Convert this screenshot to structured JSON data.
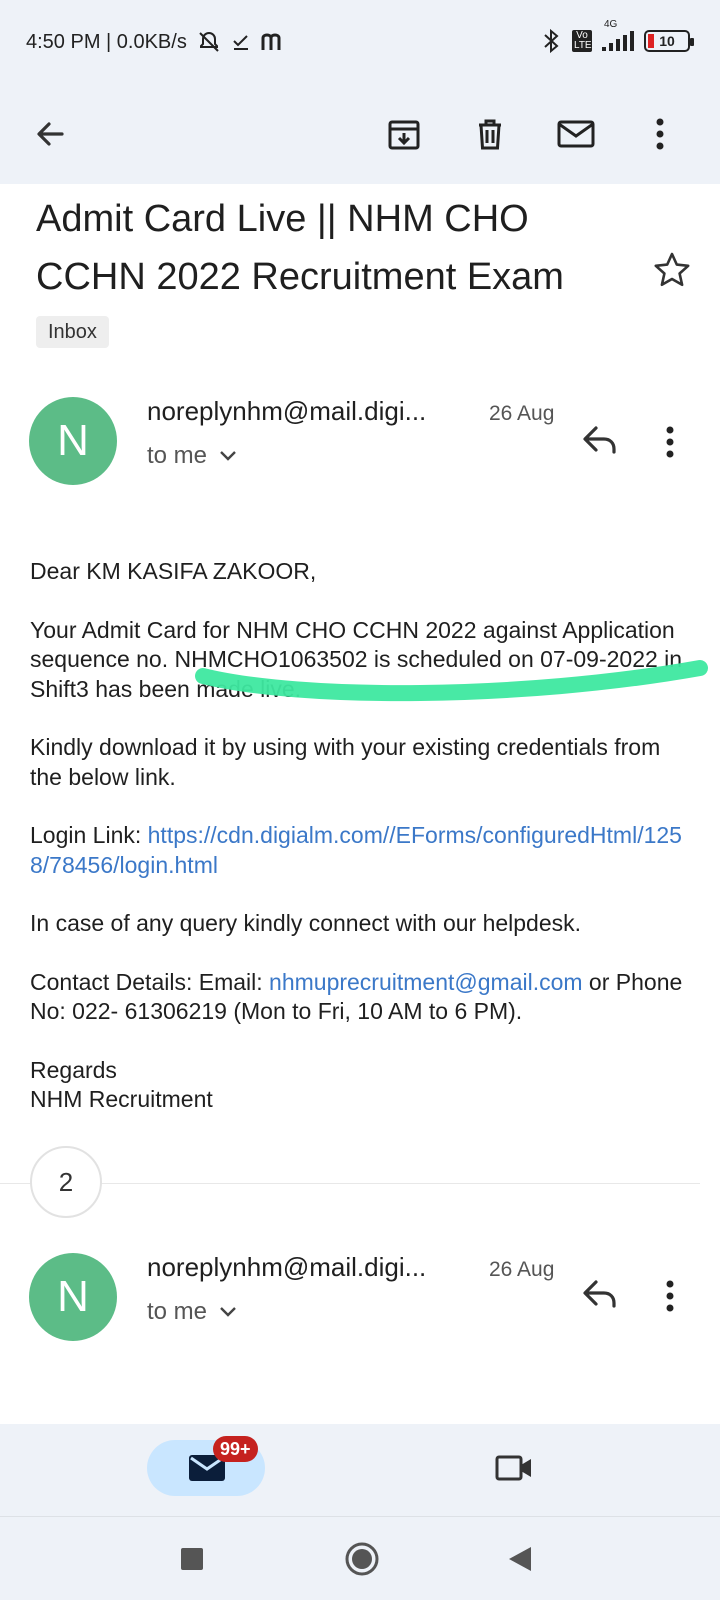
{
  "status_bar": {
    "time_text": "4:50 PM | 0.0KB/s",
    "network_type": "4G",
    "volte": "Vo LTE",
    "battery_level": "10"
  },
  "toolbar": {
    "back_icon": "arrow-left-icon",
    "archive_icon": "archive-icon",
    "delete_icon": "trash-icon",
    "mark_unread_icon": "mail-icon",
    "more_icon": "more-vert-icon"
  },
  "email": {
    "subject": "Admit Card Live || NHM CHO CCHN 2022 Recruitment Exam",
    "label": "Inbox"
  },
  "messages": [
    {
      "avatar_letter": "N",
      "sender": "noreplynhm@mail.digi...",
      "date": "26 Aug",
      "recipient": "to me"
    },
    {
      "avatar_letter": "N",
      "sender": "noreplynhm@mail.digi...",
      "date": "26 Aug",
      "recipient": "to me"
    }
  ],
  "body": {
    "greeting": "Dear KM KASIFA ZAKOOR,",
    "para1": "Your Admit Card for NHM CHO CCHN 2022 against Application sequence no. NHMCHO1063502 is scheduled on 07-09-2022 in Shift3 has been made live.",
    "para2": "Kindly download it by using with your existing credentials from the below link.",
    "login_label": "Login Link: ",
    "login_url": "https://cdn.digialm.com//EForms/configuredHtml/1258/78456/login.html",
    "para3": "In case of any query kindly connect with our helpdesk.",
    "contact_prefix": "Contact Details: Email: ",
    "contact_email": "nhmuprecruitment@gmail.com",
    "contact_suffix": " or Phone No: 022- 61306219 (Mon to Fri, 10 AM to 6 PM).",
    "regards": "Regards",
    "signature": "NHM Recruitment"
  },
  "collapsed_count": "2",
  "bottom_nav": {
    "mail_badge": "99+",
    "colors": {
      "pill": "#c9e6ff",
      "badge": "#c5221f",
      "avatar": "#5cbc87",
      "link": "#3b78c8",
      "highlighter": "#3ee8a0"
    }
  }
}
